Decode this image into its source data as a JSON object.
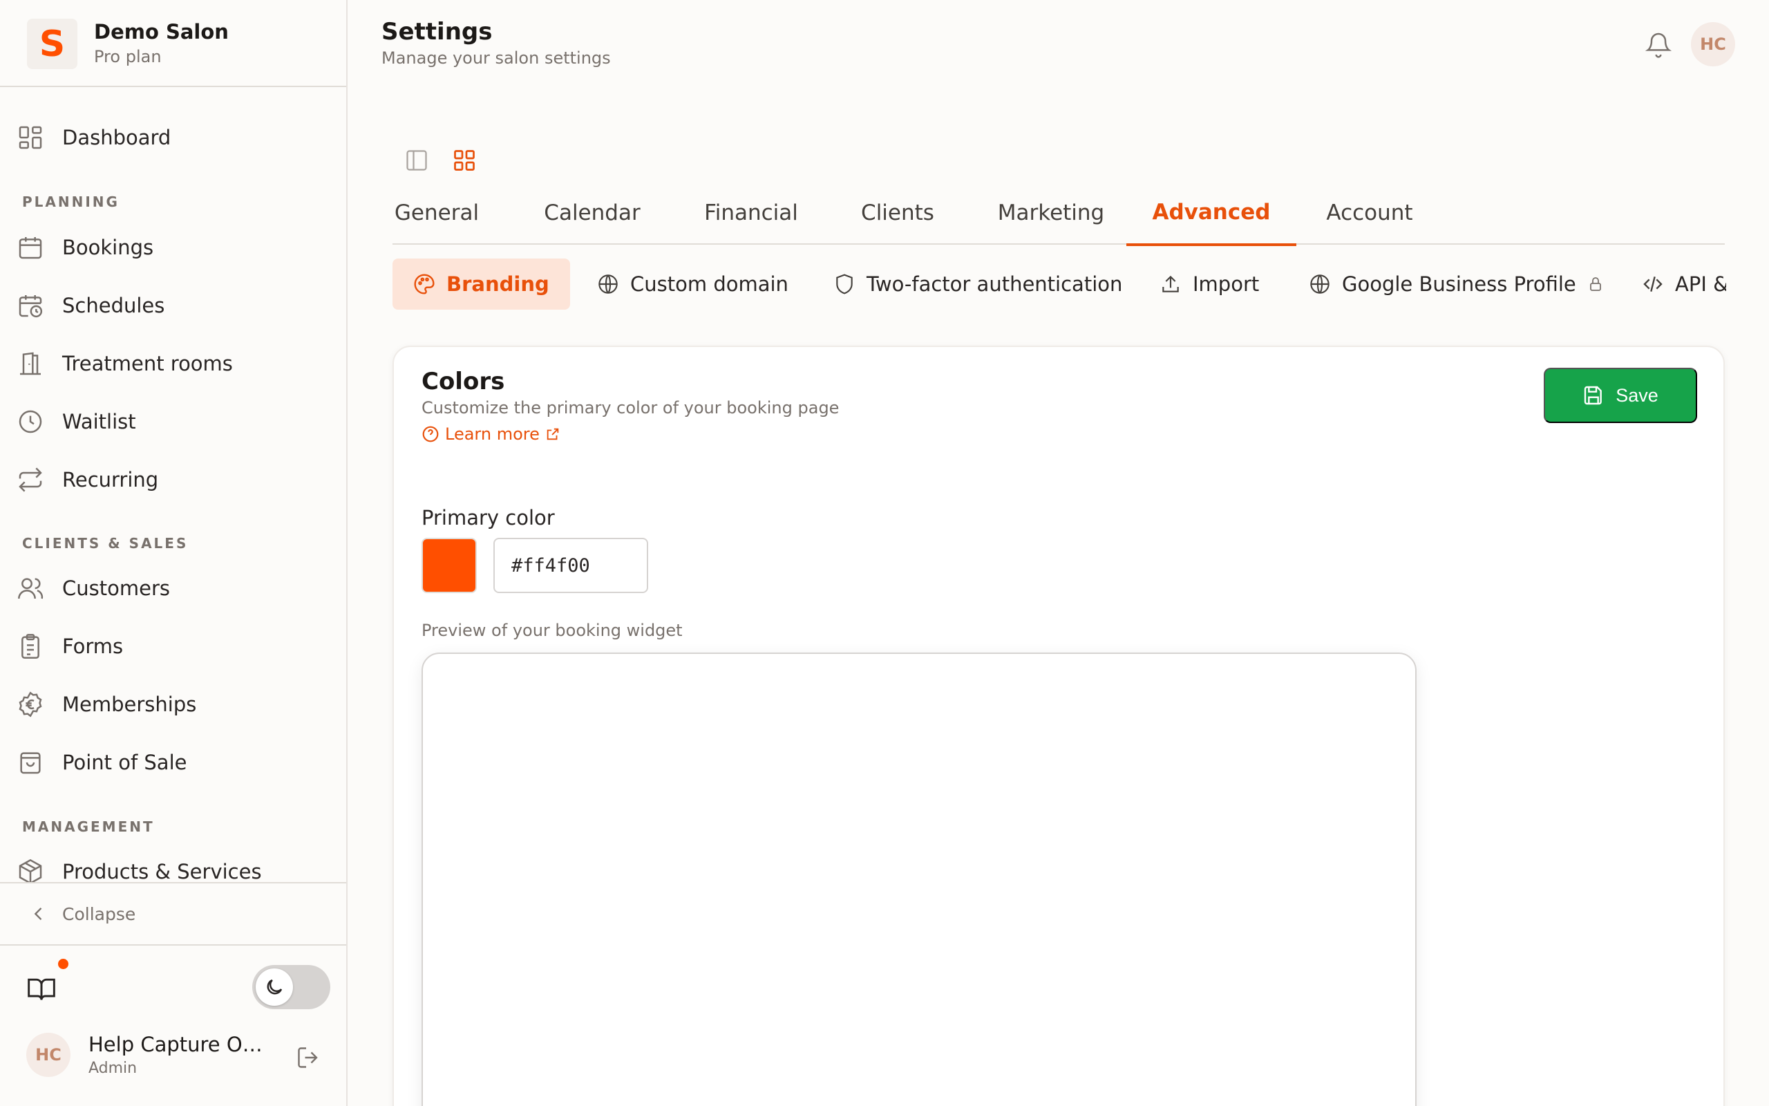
{
  "brand": {
    "logo_letter": "S",
    "name": "Demo Salon",
    "plan": "Pro plan"
  },
  "sidebar": {
    "dashboard": "Dashboard",
    "sections": {
      "planning": "PLANNING",
      "clients_sales": "CLIENTS & SALES",
      "management": "MANAGEMENT"
    },
    "items": {
      "bookings": "Bookings",
      "schedules": "Schedules",
      "treatment_rooms": "Treatment rooms",
      "waitlist": "Waitlist",
      "recurring": "Recurring",
      "customers": "Customers",
      "forms": "Forms",
      "memberships": "Memberships",
      "point_of_sale": "Point of Sale",
      "products_services": "Products & Services"
    },
    "collapse": "Collapse",
    "user": {
      "initials": "HC",
      "name": "Help Capture Ow...",
      "role": "Admin"
    }
  },
  "header": {
    "title": "Settings",
    "subtitle": "Manage your salon settings",
    "avatar_initials": "HC"
  },
  "tabs": {
    "general": "General",
    "calendar": "Calendar",
    "financial": "Financial",
    "clients": "Clients",
    "marketing": "Marketing",
    "advanced": "Advanced",
    "account": "Account",
    "active": "Advanced"
  },
  "subtabs": {
    "branding": "Branding",
    "custom_domain": "Custom domain",
    "two_factor": "Two-factor authentication",
    "import": "Import",
    "google_business": "Google Business Profile",
    "api": "API &",
    "active": "Branding"
  },
  "card": {
    "title": "Colors",
    "description": "Customize the primary color of your booking page",
    "learn_more": "Learn more",
    "save": "Save",
    "primary_color_label": "Primary color",
    "primary_color_value": "#ff4f00",
    "preview_label": "Preview of your booking widget"
  },
  "colors": {
    "accent": "#e8500a",
    "primary": "#ff4f00",
    "save_button": "#16a34a",
    "notification_dot": "#ff4f00"
  }
}
